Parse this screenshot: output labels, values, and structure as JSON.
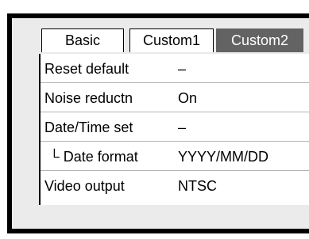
{
  "tabs": [
    {
      "label": "Basic",
      "active": false
    },
    {
      "label": "Custom1",
      "active": false
    },
    {
      "label": "Custom2",
      "active": true
    }
  ],
  "menu": {
    "rows": [
      {
        "label": "Reset default",
        "value": "–"
      },
      {
        "label": "Noise reductn",
        "value": "On"
      },
      {
        "label": "Date/Time set",
        "value": "–"
      },
      {
        "label": "└ Date format",
        "value": "YYYY/MM/DD"
      },
      {
        "label": "Video output",
        "value": "NTSC"
      }
    ]
  },
  "colors": {
    "frame": "#000000",
    "screen_bg": "#ebebeb",
    "active_tab": "#636363",
    "row_divider": "#b4b4b4"
  }
}
